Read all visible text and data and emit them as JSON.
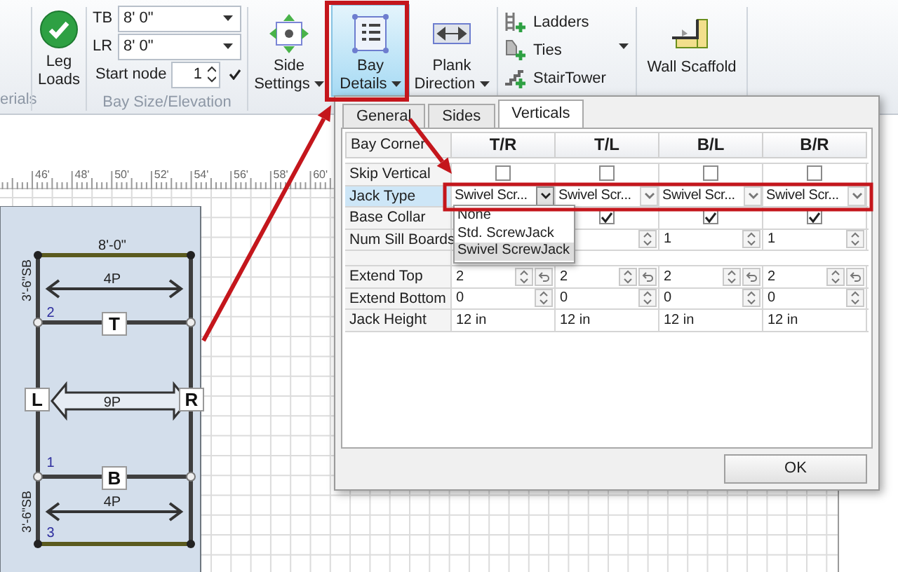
{
  "ribbon": {
    "cut_group_label": "erials",
    "leg_loads": {
      "label": "Leg Loads"
    },
    "bay_size": {
      "group_label": "Bay Size/Elevation",
      "fields": [
        {
          "label": "TB",
          "value": "8' 0\""
        },
        {
          "label": "LR",
          "value": "8' 0\""
        }
      ],
      "start_node": {
        "label": "Start node",
        "value": "1"
      }
    },
    "large_buttons": [
      {
        "label": "Side Settings",
        "kind": "move",
        "selected": false
      },
      {
        "label": "Bay Details",
        "kind": "list",
        "selected": true
      },
      {
        "label": "Plank Direction",
        "kind": "arrow",
        "selected": false
      }
    ],
    "small_buttons": [
      {
        "label": "Ladders",
        "kind": "ladder"
      },
      {
        "label": "Ties",
        "kind": "tie"
      },
      {
        "label": "StairTower",
        "kind": "stairs"
      }
    ],
    "wall_scaffold": {
      "label": "Wall Scaffold"
    }
  },
  "canvas": {
    "ruler": [
      "46'",
      "48'",
      "50'",
      "52'",
      "54'",
      "56'",
      "58'",
      "60'"
    ],
    "drawing": {
      "width_label": "8'-0\"",
      "plank_labels": [
        "4P",
        "9P",
        "4P"
      ],
      "side_markers": [
        "T",
        "L",
        "R",
        "B"
      ],
      "node_numbers": [
        "2",
        "1",
        "3"
      ],
      "side_dimensions": [
        "3'-6\"SB",
        "3'-6\"SB"
      ]
    }
  },
  "dialog": {
    "tabs": [
      {
        "label": "General",
        "selected": false
      },
      {
        "label": "Sides",
        "selected": false
      },
      {
        "label": "Verticals",
        "selected": true
      }
    ],
    "corner_label": "Bay Corner",
    "columns": [
      "T/R",
      "T/L",
      "B/L",
      "B/R"
    ],
    "rows": [
      {
        "label": "Skip Vertical",
        "kind": "checkbox",
        "selected": false,
        "cells": [
          {
            "checked": false
          },
          {
            "checked": false
          },
          {
            "checked": false
          },
          {
            "checked": false
          }
        ]
      },
      {
        "label": "Jack Type",
        "kind": "combo",
        "selected": true,
        "cells": [
          {
            "value": "Swivel Scr...",
            "open": true
          },
          {
            "value": "Swivel Scr...",
            "open": false
          },
          {
            "value": "Swivel Scr...",
            "open": false
          },
          {
            "value": "Swivel Scr...",
            "open": false
          }
        ]
      },
      {
        "label": "Base Collar",
        "kind": "checkbox",
        "selected": false,
        "cells": [
          null,
          {
            "checked": true
          },
          {
            "checked": true
          },
          {
            "checked": true
          }
        ]
      },
      {
        "label": "Num Sill Boards",
        "kind": "spin",
        "selected": false,
        "cells": [
          null,
          {},
          {
            "value": "1"
          },
          {
            "value": "1"
          }
        ]
      },
      {
        "kind": "spacer",
        "selected": false
      },
      {
        "label": "Extend Top",
        "kind": "spin_reset",
        "selected": false,
        "cells": [
          {
            "value": "2"
          },
          {
            "value": "2"
          },
          {
            "value": "2"
          },
          {
            "value": "2"
          }
        ]
      },
      {
        "label": "Extend Bottom",
        "kind": "spin",
        "selected": false,
        "cells": [
          {
            "value": "0"
          },
          {
            "value": "0"
          },
          {
            "value": "0"
          },
          {
            "value": "0"
          }
        ]
      },
      {
        "label": "Jack Height",
        "kind": "text",
        "selected": false,
        "cells": [
          {
            "value": "12 in"
          },
          {
            "value": "12 in"
          },
          {
            "value": "12 in"
          },
          {
            "value": "12 in"
          }
        ]
      }
    ],
    "dropdown": {
      "options": [
        {
          "label": "None",
          "selected": false
        },
        {
          "label": "Std. ScrewJack",
          "selected": false
        },
        {
          "label": "Swivel ScrewJack",
          "selected": true
        }
      ]
    },
    "ok_button": "OK"
  }
}
